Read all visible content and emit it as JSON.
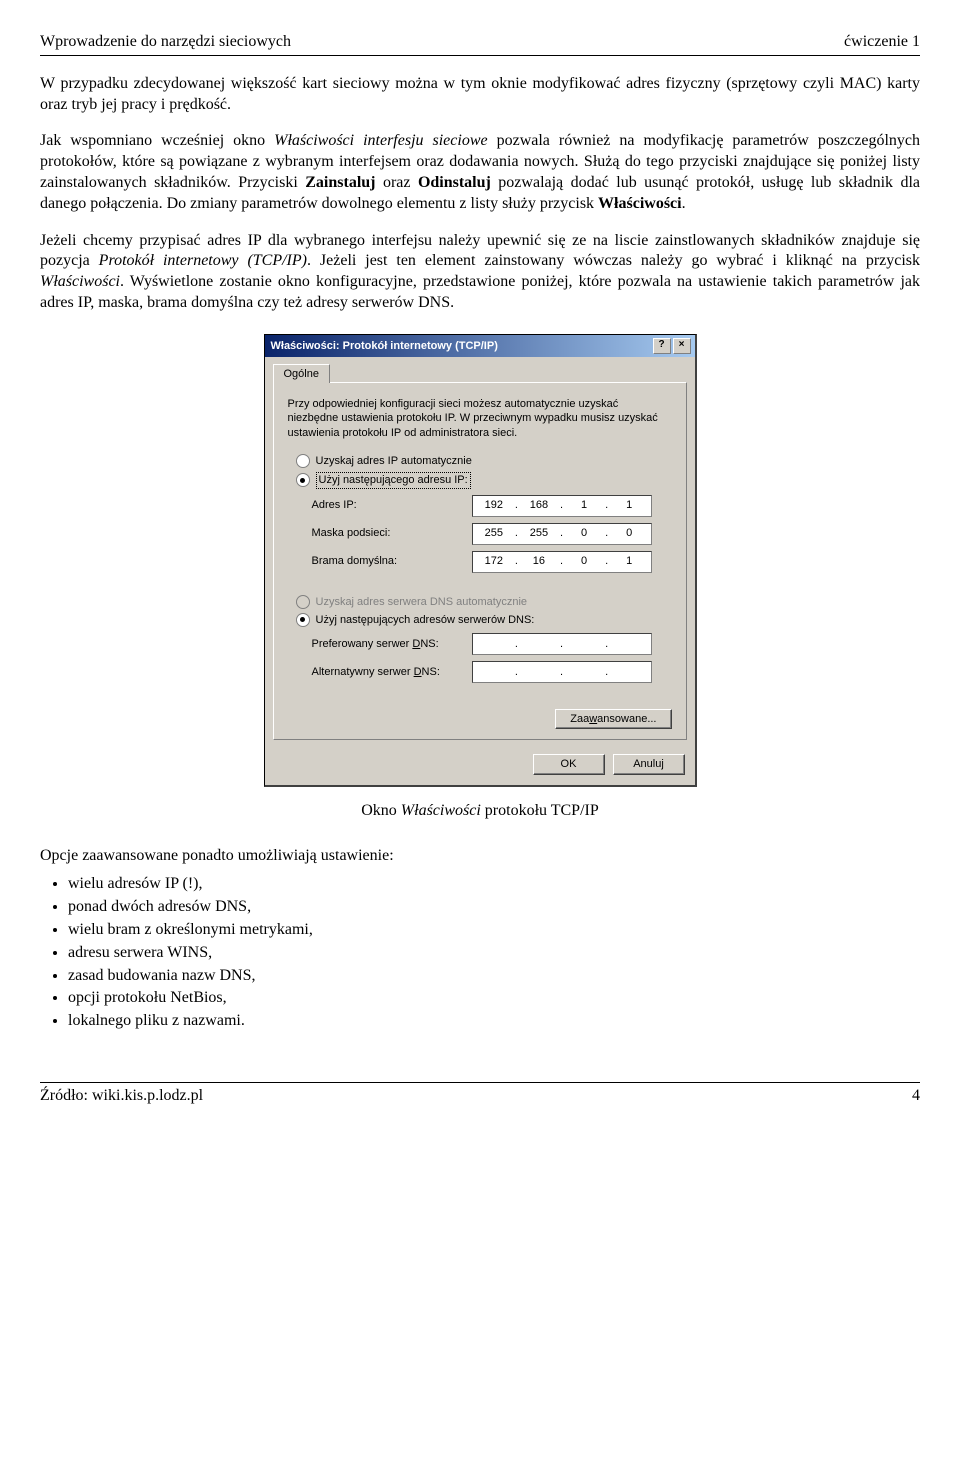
{
  "header": {
    "left": "Wprowadzenie do narzędzi sieciowych",
    "right": "ćwiczenie 1"
  },
  "para1": "W przypadku zdecydowanej większość kart sieciowy można w tym oknie modyfikować adres fizyczny (sprzętowy czyli MAC) karty oraz tryb jej pracy i prędkość.",
  "para2_a": "Jak wspomniano wcześniej okno ",
  "para2_it1": "Właściwości interfesju sieciowe",
  "para2_b": " pozwala również na modyfikację parametrów poszczególnych protokołów, które są powiązane z wybranym interfejsem oraz dodawania nowych. Służą do tego przyciski znajdujące się poniżej listy zainstalowanych składników. Przyciski ",
  "para2_bold1": "Zainstaluj",
  "para2_c": " oraz ",
  "para2_bold2": "Odinstaluj",
  "para2_d": " pozwalają dodać lub usunąć protokół, usługę lub składnik dla danego połączenia. Do zmiany parametrów dowolnego elementu z listy służy przycisk ",
  "para2_bold3": "Właściwości",
  "para2_e": ".",
  "para3_a": "Jeżeli chcemy przypisać adres IP dla wybranego interfejsu należy upewnić się ze na liscie zainstlowanych składników znajduje się pozycja ",
  "para3_it1": "Protokół internetowy (TCP/IP)",
  "para3_b": ". Jeżeli jest ten element zainstowany wówczas należy go wybrać i kliknąć na przycisk ",
  "para3_it2": "Właściwości",
  "para3_c": ". Wyświetlone zostanie okno konfiguracyjne, przedstawione poniżej, które pozwala na ustawienie takich parametrów jak adres IP, maska, brama domyślna czy też adresy serwerów DNS.",
  "dialog": {
    "title": "Właściwości: Protokół internetowy (TCP/IP)",
    "tab": "Ogólne",
    "desc": "Przy odpowiedniej konfiguracji sieci możesz automatycznie uzyskać niezbędne ustawienia protokołu IP. W przeciwnym wypadku musisz uzyskać ustawienia protokołu IP od administratora sieci.",
    "radio_ip_auto": "Uzyskaj adres IP automatycznie",
    "radio_ip_manual": "Użyj następującego adresu IP:",
    "lbl_ip": "Adres IP:",
    "lbl_mask": "Maska podsieci:",
    "lbl_gw": "Brama domyślna:",
    "ip": [
      "192",
      "168",
      "1",
      "1"
    ],
    "mask": [
      "255",
      "255",
      "0",
      "0"
    ],
    "gw": [
      "172",
      "16",
      "0",
      "1"
    ],
    "radio_dns_auto": "Uzyskaj adres serwera DNS automatycznie",
    "radio_dns_manual": "Użyj następujących adresów serwerów DNS:",
    "lbl_dns1_a": "Preferowany serwer ",
    "lbl_dns1_b": "D",
    "lbl_dns1_c": "NS:",
    "lbl_dns2_a": "Alternatywny serwer ",
    "lbl_dns2_b": "D",
    "lbl_dns2_c": "NS:",
    "btn_adv_a": "Zaa",
    "btn_adv_b": "w",
    "btn_adv_c": "ansowane...",
    "btn_ok": "OK",
    "btn_cancel": "Anuluj",
    "help_glyph": "?",
    "close_glyph": "×"
  },
  "caption_a": "Okno ",
  "caption_it": "Właściwości",
  "caption_b": " protokołu TCP/IP",
  "para4": "Opcje zaawansowane ponadto umożliwiają ustawienie:",
  "options": [
    "wielu adresów IP (!),",
    "ponad dwóch adresów DNS,",
    "wielu bram z określonymi metrykami,",
    "adresu serwera WINS,",
    "zasad budowania nazw DNS,",
    "opcji protokołu NetBios,",
    "lokalnego pliku z nazwami."
  ],
  "footer": {
    "left": "Źródło: wiki.kis.p.lodz.pl",
    "right": "4"
  }
}
